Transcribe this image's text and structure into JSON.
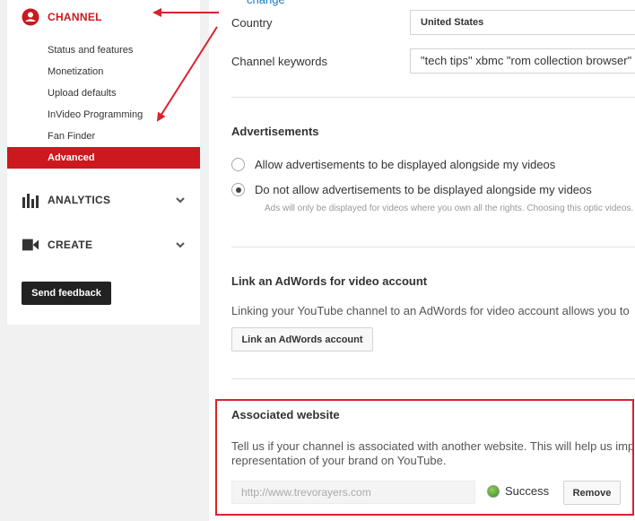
{
  "sidebar": {
    "channel_label": "CHANNEL",
    "items": [
      {
        "label": "Status and features"
      },
      {
        "label": "Monetization"
      },
      {
        "label": "Upload defaults"
      },
      {
        "label": "InVideo Programming"
      },
      {
        "label": "Fan Finder"
      },
      {
        "label": "Advanced",
        "active": true
      }
    ],
    "analytics_label": "ANALYTICS",
    "create_label": "CREATE",
    "feedback_button": "Send feedback"
  },
  "main": {
    "change_link": "change",
    "country_label": "Country",
    "country_value": "United States",
    "keywords_label": "Channel keywords",
    "keywords_value": "\"tech tips\" xbmc \"rom collection browser\"",
    "ads": {
      "title": "Advertisements",
      "option_allow": "Allow advertisements to be displayed alongside my videos",
      "option_disallow": "Do not allow advertisements to be displayed alongside my videos",
      "selected": "disallow",
      "note": "Ads will only be displayed for videos where you own all the rights. Choosing this optic videos."
    },
    "adwords": {
      "title": "Link an AdWords for video account",
      "description": "Linking your YouTube channel to an AdWords for video account allows you to",
      "button": "Link an AdWords account"
    },
    "website": {
      "title": "Associated website",
      "description_line1": "Tell us if your channel is associated with another website. This will help us imp",
      "description_line2": "representation of your brand on YouTube.",
      "placeholder": "http://www.trevorayers.com",
      "status": "Success",
      "remove_button": "Remove"
    }
  },
  "colors": {
    "accent": "#cc181e",
    "annotation": "#d9232e",
    "link": "#167ac6"
  }
}
